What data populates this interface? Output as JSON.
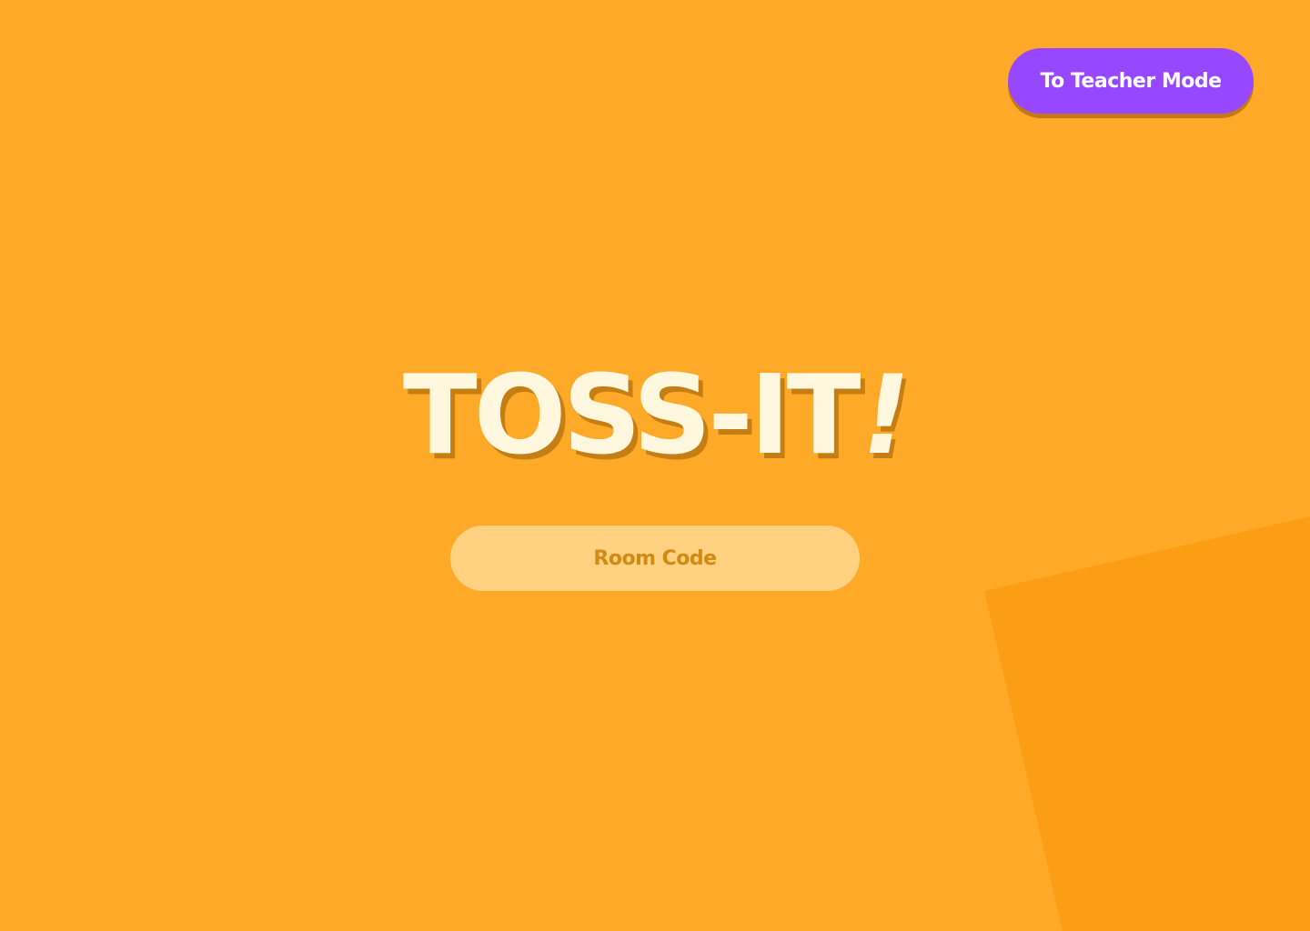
{
  "header": {
    "teacher_mode_label": "To Teacher Mode"
  },
  "main": {
    "title_main": "TOSS-IT",
    "title_bang": "!",
    "room_code_placeholder": "Room Code",
    "room_code_value": ""
  },
  "colors": {
    "background": "#FFA928",
    "background_shape": "#FB9E14",
    "accent_button": "#9747FF",
    "title_text": "#FFF8DF",
    "title_shadow": "#C47E14",
    "input_bg": "#FFD180",
    "input_text": "#D18A12"
  }
}
